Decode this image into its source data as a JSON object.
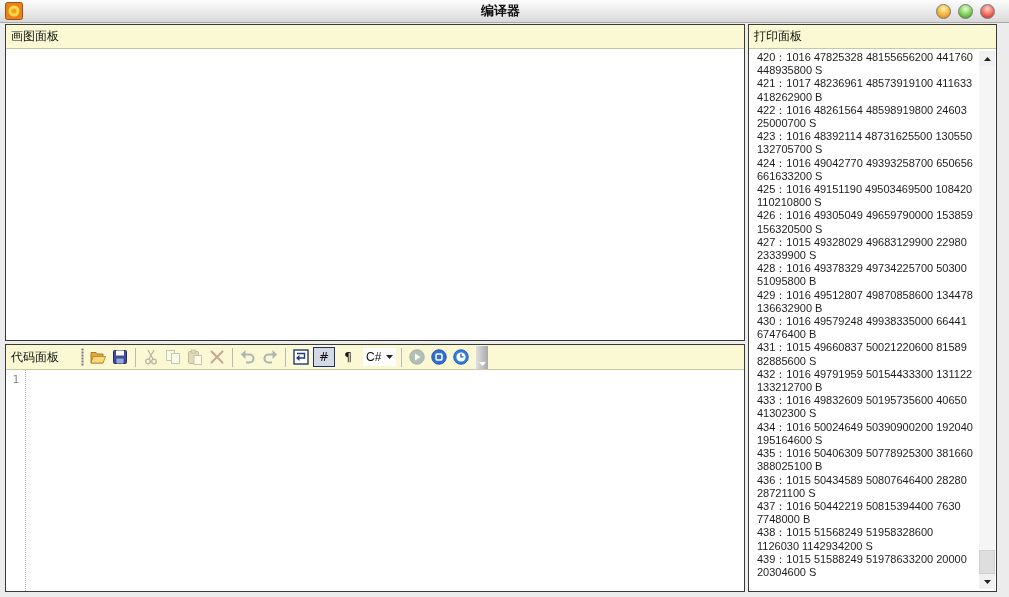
{
  "window": {
    "title": "编译器"
  },
  "draw_panel": {
    "title": "画图面板"
  },
  "code_panel": {
    "title": "代码面板",
    "toolbar": [
      {
        "kind": "button",
        "disabled": false
      },
      {
        "kind": "button",
        "disabled": false
      },
      {
        "kind": "separator"
      },
      {
        "kind": "button",
        "disabled": true
      },
      {
        "kind": "button",
        "disabled": true
      },
      {
        "kind": "button",
        "disabled": true
      },
      {
        "kind": "button",
        "disabled": true
      },
      {
        "kind": "separator"
      },
      {
        "kind": "button",
        "disabled": true
      },
      {
        "kind": "button",
        "disabled": true
      },
      {
        "kind": "separator"
      },
      {
        "kind": "button",
        "disabled": false
      },
      {
        "kind": "toggle",
        "checked": true,
        "label": "#"
      },
      {
        "kind": "button",
        "disabled": false,
        "label": "¶"
      },
      {
        "kind": "dropdown",
        "value": "C#"
      },
      {
        "kind": "separator"
      },
      {
        "kind": "button",
        "disabled": true
      },
      {
        "kind": "button",
        "disabled": false
      },
      {
        "kind": "button",
        "disabled": false
      }
    ],
    "line_numbers": [
      "1"
    ]
  },
  "print_panel": {
    "title": "打印面板",
    "lines": [
      "420：1016 47825328 48155656200 441760 448935800 S",
      "421：1017 48236961 48573919100 411633 418262900 B",
      "422：1016 48261564 48598919800 24603 25000700 S",
      "423：1016 48392114 48731625500 130550 132705700 S",
      "424：1016 49042770 49393258700 650656 661633200 S",
      "425：1016 49151190 49503469500 108420 110210800 S",
      "426：1016 49305049 49659790000 153859 156320500 S",
      "427：1015 49328029 49683129900 22980 23339900 S",
      "428：1016 49378329 49734225700 50300 51095800 B",
      "429：1016 49512807 49870858600 134478 136632900 B",
      "430：1016 49579248 49938335000 66441 67476400 B",
      "431：1015 49660837 50021220600 81589 82885600 S",
      "432：1016 49791959 50154433300 131122 133212700 B",
      "433：1016 49832609 50195735600 40650 41302300 S",
      "434：1016 50024649 50390900200 192040 195164600 S",
      "435：1016 50406309 50778925300 381660 388025100 B",
      "436：1015 50434589 50807646400 28280 28721100 S",
      "437：1016 50442219 50815394400 7630 7748000 B",
      "438：1015 51568249 51958328600 1126030 1142934200 S",
      "439：1015 51588249 51978633200 20000 20304600 S"
    ]
  }
}
